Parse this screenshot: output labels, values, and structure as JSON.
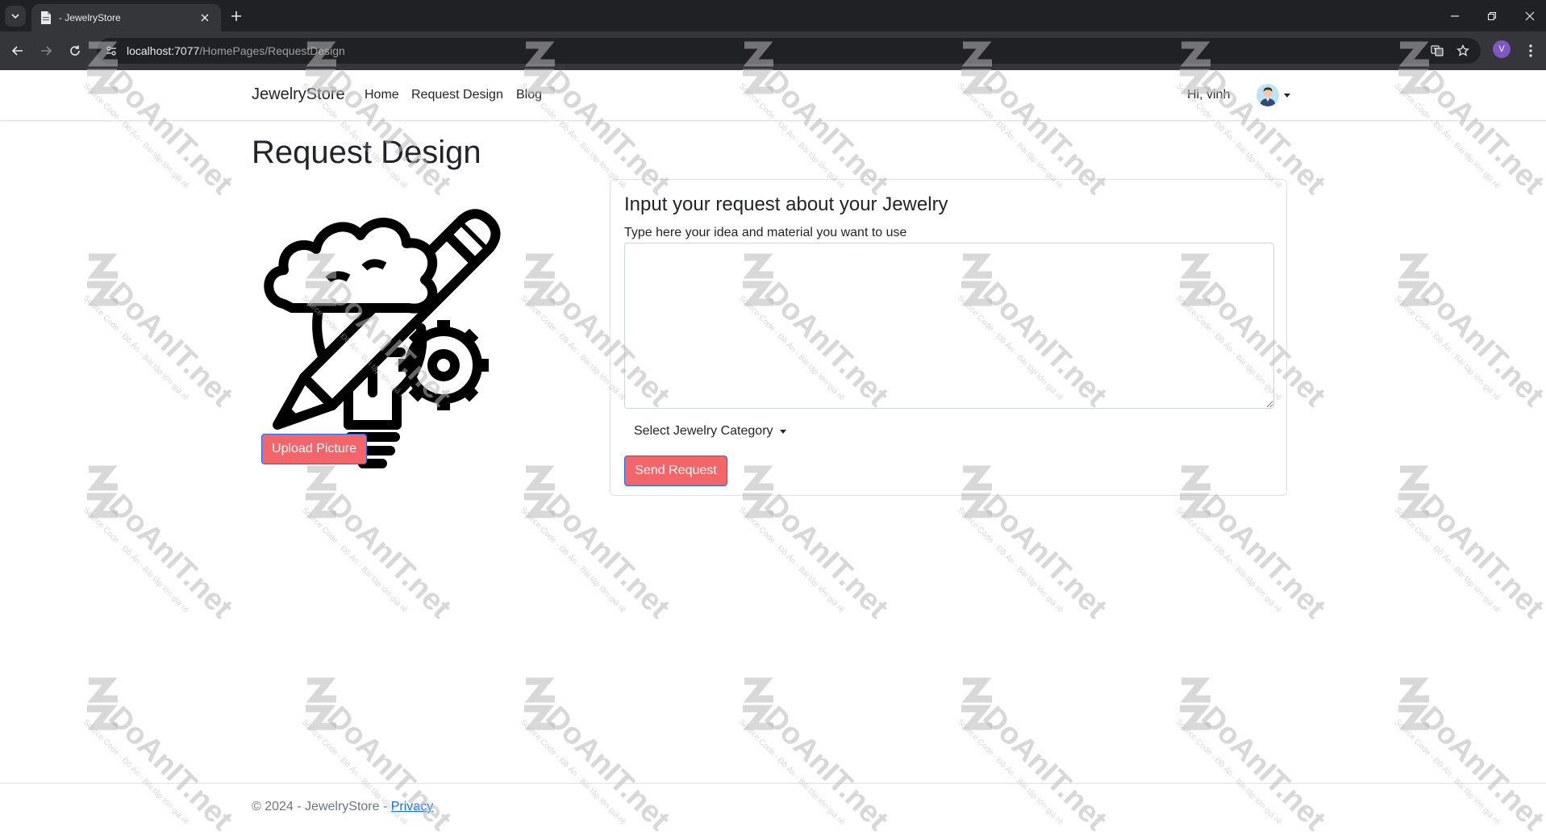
{
  "browser": {
    "tab_title": "- JewelryStore",
    "url_host": "localhost:7077",
    "url_path": "/HomePages/RequestDesign",
    "profile_initial": "V"
  },
  "navbar": {
    "brand": "JewelryStore",
    "links": [
      "Home",
      "Request Design",
      "Blog"
    ],
    "greeting": "Hi, vinh"
  },
  "main": {
    "title": "Request Design",
    "upload_button": "Upload Picture",
    "image_icon": "design-idea-icon"
  },
  "request_card": {
    "heading": "Input your request about your Jewelry",
    "textarea_label": "Type here your idea and material you want to use",
    "textarea_value": "",
    "category_dropdown": "Select Jewelry Category",
    "send_button": "Send Request"
  },
  "footer": {
    "copyright": "© 2024 - JewelryStore - ",
    "privacy_link": "Privacy"
  },
  "watermark": {
    "brand": "DoAnIT.net",
    "tagline": "Source Code - Đồ Án - Bài tập lớn giá rẻ"
  },
  "colors": {
    "button_bg": "#f36569",
    "button_border": "#0d6efd",
    "browser_dark": "#202124",
    "browser_toolbar": "#35363a"
  }
}
